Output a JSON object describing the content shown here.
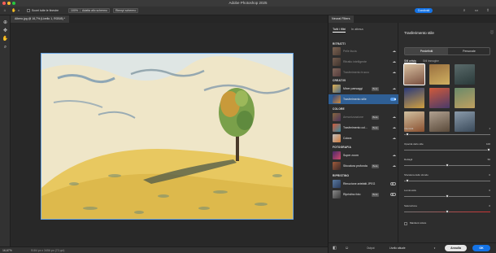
{
  "app": {
    "title": "Adobe Photoshop 2025"
  },
  "options_bar": {
    "scroll_all_label": "Scorri tutte le finestre",
    "zoom_100_label": "100%",
    "fit_screen_label": "Adatta allo schermo",
    "fill_screen_label": "Riempi schermo",
    "share_label": "Condividi"
  },
  "document": {
    "tab_label": "Albero.jpg @ 16,7% (Livello 1, RGB/8) *",
    "zoom": "16,67%",
    "info": "5184 px x 3456 px (72 ppi)"
  },
  "panel": {
    "title": "Neural Filters",
    "tabs": [
      "Tutti i filtri",
      "In attesa"
    ],
    "categories": {
      "ritratti": "RITRATTI",
      "creativi": "CREATIVI",
      "colore": "COLORE",
      "fotografia": "FOTOGRAFIA",
      "ripristino": "RIPRISTINO"
    },
    "filters": [
      {
        "name": "Pelle liscia",
        "badge": ""
      },
      {
        "name": "Ritratto intelligente",
        "badge": ""
      },
      {
        "name": "Trasferimento trucco",
        "badge": ""
      },
      {
        "name": "Mixer paesaggi",
        "badge": "Beta"
      },
      {
        "name": "Trasferimento stile",
        "badge": ""
      },
      {
        "name": "Armonizzazione",
        "badge": "Beta"
      },
      {
        "name": "Trasferimento col...",
        "badge": "Beta"
      },
      {
        "name": "Colora",
        "badge": ""
      },
      {
        "name": "Super zoom",
        "badge": ""
      },
      {
        "name": "Sfocatura profonda",
        "badge": "Beta"
      },
      {
        "name": "Rimozione artefatti JPEG",
        "badge": ""
      },
      {
        "name": "Ripristino foto",
        "badge": "Beta"
      }
    ]
  },
  "style_panel": {
    "title": "Trasferimento stile",
    "segments": [
      "Predefiniti",
      "Personale"
    ],
    "subtabs": [
      "Stili artista",
      "Stili immagine"
    ],
    "sliders": [
      {
        "label": "Intensità",
        "value": "1",
        "fraction": 0.02
      },
      {
        "label": "Opacità dello stile",
        "value": "100",
        "fraction": 1.0
      },
      {
        "label": "Dettagli",
        "value": "50",
        "fraction": 0.5
      },
      {
        "label": "Sfocatura dello sfondo",
        "value": "0",
        "fraction": 0.02
      },
      {
        "label": "Luminosità",
        "value": "0",
        "fraction": 0.5
      },
      {
        "label": "Saturazione",
        "value": "0",
        "fraction": 0.5
      }
    ],
    "preserve_color_label": "Mantieni colore"
  },
  "footer": {
    "output_label": "Output",
    "output_value": "Livello attuale",
    "cancel_label": "Annulla",
    "ok_label": "OK"
  }
}
